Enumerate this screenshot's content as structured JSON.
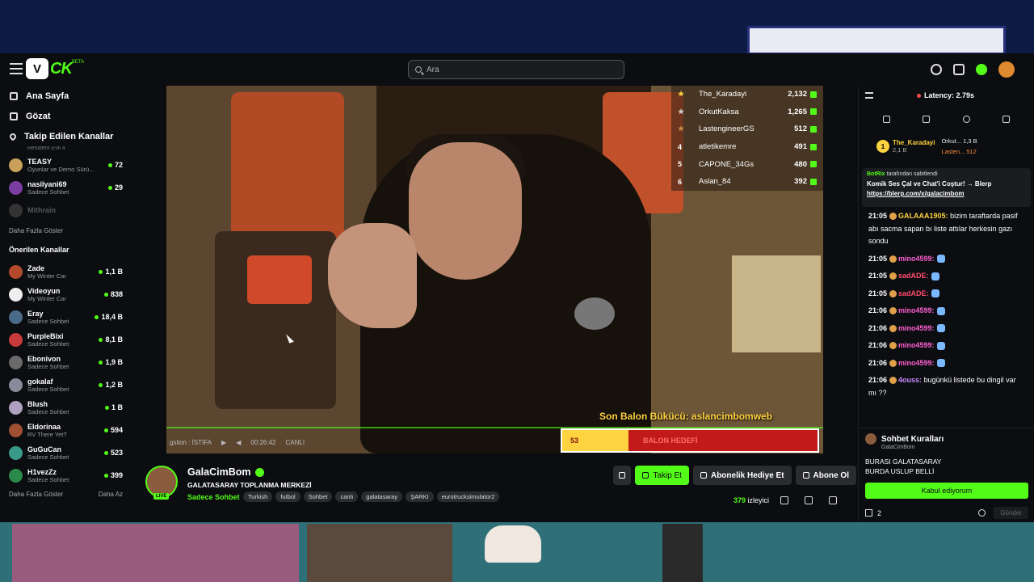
{
  "header": {
    "logo_text": "CK",
    "logo_beta": "BETA",
    "search_placeholder": "Ara"
  },
  "nav": [
    {
      "label": "Ana Sayfa",
      "icon": "home-icon"
    },
    {
      "label": "Gözat",
      "icon": "browse-icon"
    },
    {
      "label": "Takip Edilen Kanallar",
      "icon": "heart-icon"
    }
  ],
  "followed_partial": "Resident Evil 4",
  "followed": [
    {
      "name": "TEASY",
      "category": "Oyunlar ve Demo Sürü...",
      "viewers": "72"
    },
    {
      "name": "nasilyani69",
      "category": "Sadece Sohbet",
      "viewers": "29"
    },
    {
      "name": "Mithrain",
      "category": "",
      "viewers": ""
    }
  ],
  "show_more": "Daha Fazla Göster",
  "recommended_title": "Önerilen Kanallar",
  "recommended": [
    {
      "name": "Zade",
      "category": "My Winter Car",
      "viewers": "1,1 B"
    },
    {
      "name": "Videoyun",
      "category": "My Winter Car",
      "viewers": "838"
    },
    {
      "name": "Eray",
      "category": "Sadece Sohbet",
      "viewers": "18,4 B"
    },
    {
      "name": "PurpleBixi",
      "category": "Sadece Sohbet",
      "viewers": "8,1 B"
    },
    {
      "name": "Ebonivon",
      "category": "Sadece Sohbet",
      "viewers": "1,9 B"
    },
    {
      "name": "gokalaf",
      "category": "Sadece Sohbet",
      "viewers": "1,2 B"
    },
    {
      "name": "Blush",
      "category": "Sadece Sohbet",
      "viewers": "1 B"
    },
    {
      "name": "Eldorinaa",
      "category": "RV There Yet?",
      "viewers": "594"
    },
    {
      "name": "GuGuCan",
      "category": "Sadece Sohbet",
      "viewers": "523"
    },
    {
      "name": "H1vezZz",
      "category": "Sadece Sohbet",
      "viewers": "399"
    }
  ],
  "sidebar_footer": {
    "more": "Daha Fazla Göster",
    "less": "Daha Az"
  },
  "video": {
    "leaderboard": [
      {
        "rank": "",
        "name": "The_Karadayi",
        "amount": "2,132"
      },
      {
        "rank": "",
        "name": "OrkutKaksa",
        "amount": "1,265"
      },
      {
        "rank": "",
        "name": "LastengineerGS",
        "amount": "512"
      },
      {
        "rank": "4",
        "name": "atletikemre",
        "amount": "491"
      },
      {
        "rank": "5",
        "name": "CAPONE_34Gs",
        "amount": "480"
      },
      {
        "rank": "6",
        "name": "Aslan_84",
        "amount": "392"
      }
    ],
    "balloon_text": "Son Balon Bükücü: aslancimbomweb",
    "goal_number": "53",
    "goal_label": "BALON HEDEFİ",
    "goal_progress": 0.26,
    "overlay_caption": "gslion : İSTİFA",
    "time": "00:26:42",
    "live_label": "CANLI"
  },
  "stream": {
    "channel": "GalaCimBom",
    "title": "GALATASARAY TOPLANMA MERKEZİ",
    "category": "Sadece Sohbet",
    "tags": [
      "Turkish",
      "futbol",
      "Sohbet",
      "canlı",
      "galatasaray",
      "ŞARKI",
      "eurotrucksimulator2"
    ],
    "live_badge": "LIVE",
    "follow": "Takip Et",
    "gift_sub": "Abonelik Hediye Et",
    "subscribe": "Abone Ol",
    "viewers_count": "379",
    "viewers_label": "izleyici"
  },
  "chat": {
    "latency": "Latency: 2.79s",
    "top_gifter_1": {
      "rank": "1",
      "name": "The_Karadayi",
      "amount": "2,1 B"
    },
    "top_gifter_2": "Orkut... 1,3 B",
    "top_gifter_3": "Lasten... 512",
    "pinned_by_user": "BotRix",
    "pinned_by_suffix": "tarafından sabitlendi",
    "pinned_msg": "Komik Ses Çal ve Chat'i Coştur! → Blerp",
    "pinned_link": "https://blerp.com/x/galacimbom",
    "messages": [
      {
        "time": "21:05",
        "user": "GALAAA1905:",
        "color": "#ffd23f",
        "text": "bizim taraftarda pasif abı sacma sapan bı liste attılar herkesin gazı sondu"
      },
      {
        "time": "21:05",
        "user": "mino4599:",
        "color": "#ff5fd2",
        "text": ""
      },
      {
        "time": "21:05",
        "user": "sadADE:",
        "color": "#ff4d6d",
        "text": ""
      },
      {
        "time": "21:05",
        "user": "sadADE:",
        "color": "#ff4d6d",
        "text": ""
      },
      {
        "time": "21:06",
        "user": "mino4599:",
        "color": "#ff5fd2",
        "text": ""
      },
      {
        "time": "21:06",
        "user": "mino4599:",
        "color": "#ff5fd2",
        "text": ""
      },
      {
        "time": "21:06",
        "user": "mino4599:",
        "color": "#ff5fd2",
        "text": ""
      },
      {
        "time": "21:06",
        "user": "mino4599:",
        "color": "#ff5fd2",
        "text": ""
      },
      {
        "time": "21:06",
        "user": "4ouss:",
        "color": "#c98bff",
        "text": "bugünkü listede bu dingil var mı ??"
      }
    ],
    "rules_title": "Sohbet Kuralları",
    "rules_channel": "GalaCimBom",
    "rules_text_1": "BURASI GALATASARAY",
    "rules_text_2": "BURDA USLUP BELLİ",
    "rules_accept": "Kabul ediyorum",
    "user_count": "2",
    "send": "Gönder"
  },
  "colors": {
    "accent": "#53fc18",
    "bg": "#0b0d10",
    "gold": "#ffd23f"
  }
}
